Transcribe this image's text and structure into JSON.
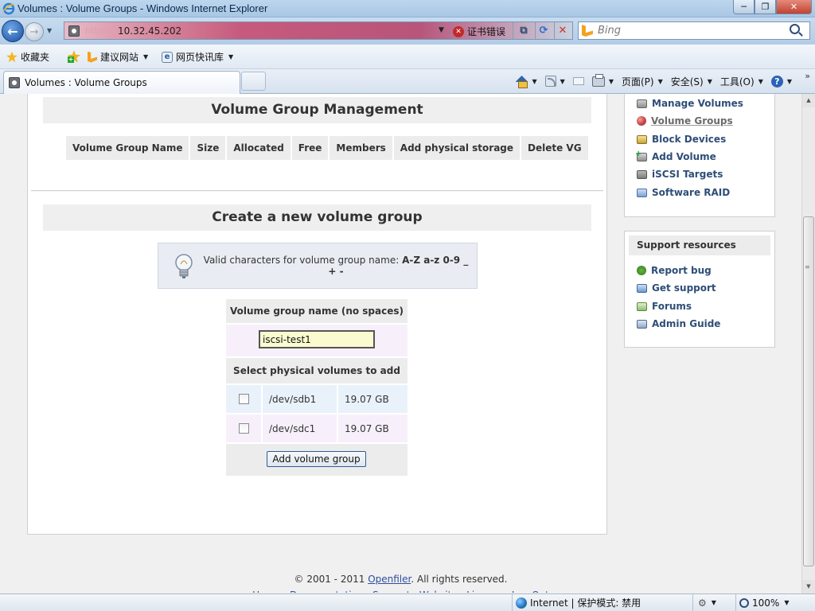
{
  "window": {
    "title": "Volumes : Volume Groups - Windows Internet Explorer",
    "minimize": "─",
    "maximize": "❐",
    "close": "✕"
  },
  "address_bar": {
    "protocol": "https://",
    "host": "10.32.45.202",
    "cert_error": "证书错误",
    "search_placeholder": "Bing"
  },
  "favorites_bar": {
    "favorites": "收藏夹",
    "suggested_sites": "建议网站",
    "web_slice_gallery": "网页快讯库"
  },
  "tab": {
    "title": "Volumes : Volume Groups"
  },
  "command_bar": {
    "page": "页面(P)",
    "safety": "安全(S)",
    "tools": "工具(O)",
    "more": "»"
  },
  "vg_management": {
    "title": "Volume Group Management",
    "columns": [
      "Volume Group Name",
      "Size",
      "Allocated",
      "Free",
      "Members",
      "Add physical storage",
      "Delete VG"
    ]
  },
  "create_vg": {
    "title": "Create a new volume group",
    "tip_text": "Valid characters for volume group name: ",
    "tip_chars": "A-Z a-z 0-9 _ + -",
    "name_header": "Volume group name (no spaces)",
    "name_value": "iscsi-test1",
    "pv_header": "Select physical volumes to add",
    "physical_volumes": [
      {
        "device": "/dev/sdb1",
        "size": "19.07 GB",
        "checked": false
      },
      {
        "device": "/dev/sdc1",
        "size": "19.07 GB",
        "checked": false
      }
    ],
    "submit_label": "Add volume group"
  },
  "sidebar": {
    "volumes_section": {
      "items": [
        {
          "label": "Manage Volumes",
          "icon": "drive-icon"
        },
        {
          "label": "Volume Groups",
          "icon": "volume-group-icon",
          "active": true
        },
        {
          "label": "Block Devices",
          "icon": "block-device-icon"
        },
        {
          "label": "Add Volume",
          "icon": "add-volume-icon"
        },
        {
          "label": "iSCSI Targets",
          "icon": "iscsi-icon"
        },
        {
          "label": "Software RAID",
          "icon": "raid-icon"
        }
      ]
    },
    "support": {
      "title": "Support resources",
      "items": [
        {
          "label": "Report bug",
          "icon": "bug-icon"
        },
        {
          "label": "Get support",
          "icon": "support-icon"
        },
        {
          "label": "Forums",
          "icon": "forum-icon"
        },
        {
          "label": "Admin Guide",
          "icon": "guide-icon"
        }
      ]
    }
  },
  "footer": {
    "copyright_prefix": "© 2001 - 2011 ",
    "brand": "Openfiler",
    "copyright_suffix": ". All rights reserved.",
    "links": "Home · Documentation · Support · Website · License · Log Out"
  },
  "status_bar": {
    "zone": "Internet | 保护模式: 禁用",
    "zoom": "100%"
  }
}
